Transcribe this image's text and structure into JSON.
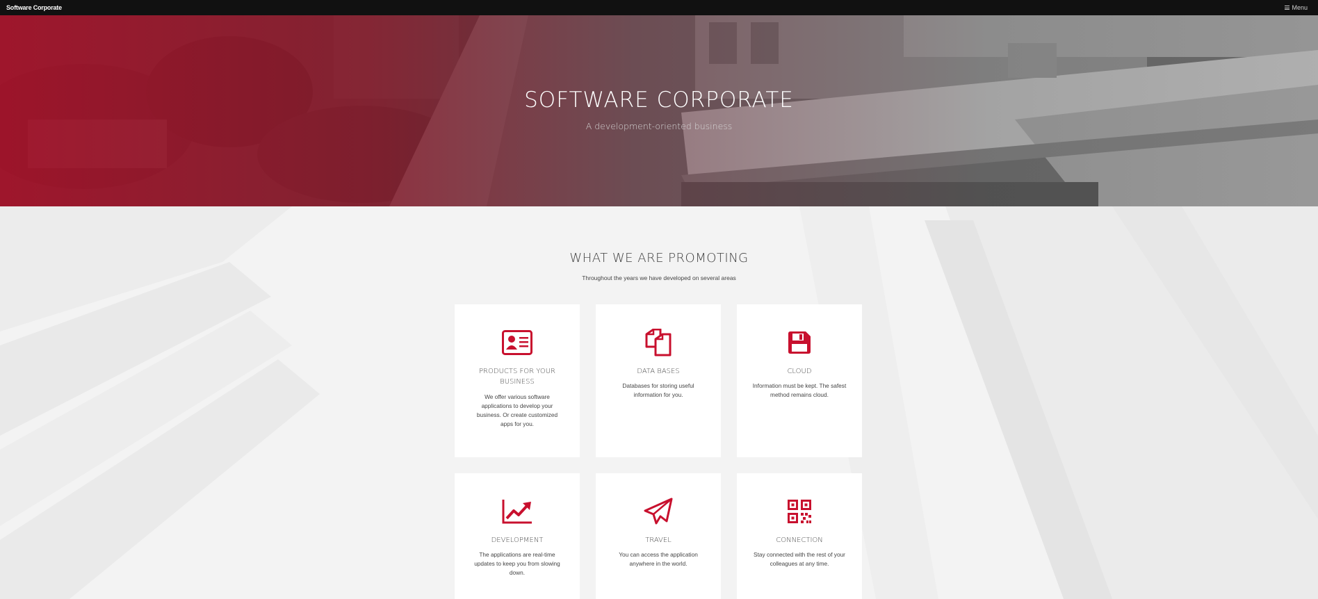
{
  "navbar": {
    "brand": "Software Corporate",
    "menu_label": "Menu",
    "menu_icon": "bars-icon"
  },
  "hero": {
    "title": "SOFTWARE CORPORATE",
    "subtitle": "A development-oriented business"
  },
  "services": {
    "title": "WHAT WE ARE PROMOTING",
    "subtitle": "Throughout the years we have developed on several areas",
    "accent_color": "#c8102e",
    "cards": [
      {
        "icon": "id-card-icon",
        "title": "PRODUCTS FOR YOUR BUSINESS",
        "text": "We offer various software applications to develop your business. Or create customized apps for you."
      },
      {
        "icon": "copy-icon",
        "title": "DATA BASES",
        "text": "Databases for storing useful information for you."
      },
      {
        "icon": "floppy-disk-icon",
        "title": "CLOUD",
        "text": "Information must be kept. The safest method remains cloud."
      },
      {
        "icon": "chart-line-icon",
        "title": "DEVELOPMENT",
        "text": "The applications are real-time updates to keep you from slowing down."
      },
      {
        "icon": "paper-plane-icon",
        "title": "TRAVEL",
        "text": "You can access the application anywhere in the world."
      },
      {
        "icon": "qr-code-icon",
        "title": "CONNECTION",
        "text": "Stay connected with the rest of your colleagues at any time."
      }
    ]
  }
}
